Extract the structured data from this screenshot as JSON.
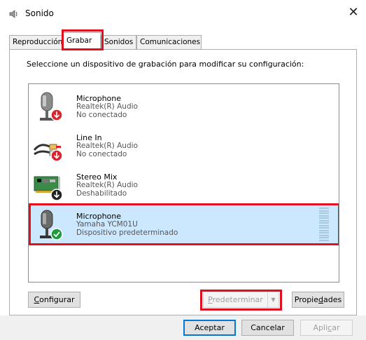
{
  "window": {
    "title": "Sonido",
    "icon": "speaker-icon",
    "close_glyph": "✕"
  },
  "tabs": [
    {
      "label": "Reproducción",
      "active": false
    },
    {
      "label": "Grabar",
      "active": true
    },
    {
      "label": "Sonidos",
      "active": false
    },
    {
      "label": "Comunicaciones",
      "active": false
    }
  ],
  "instruction": "Seleccione un dispositivo de grabación para modificar su configuración:",
  "devices": [
    {
      "name": "Microphone",
      "driver": "Realtek(R) Audio",
      "status": "No conectado",
      "icon": "microphone-icon",
      "badge": "disconnected-down-arrow",
      "selected": false
    },
    {
      "name": "Line In",
      "driver": "Realtek(R) Audio",
      "status": "No conectado",
      "icon": "line-in-cable-icon",
      "badge": "disconnected-down-arrow",
      "selected": false
    },
    {
      "name": "Stereo Mix",
      "driver": "Realtek(R) Audio",
      "status": "Deshabilitado",
      "icon": "sound-card-icon",
      "badge": "disabled-down-arrow",
      "selected": false
    },
    {
      "name": "Microphone",
      "driver": "Yamaha YCM01U",
      "status": "Dispositivo predeterminado",
      "icon": "microphone-icon",
      "badge": "default-check",
      "selected": true
    }
  ],
  "buttons": {
    "configure": {
      "pre": "",
      "ul": "C",
      "post": "onfigurar"
    },
    "set_default": {
      "pre": "",
      "ul": "P",
      "post": "redeterminar",
      "enabled": false
    },
    "properties": {
      "pre": "Propie",
      "ul": "d",
      "post": "ades"
    },
    "ok": "Aceptar",
    "cancel": "Cancelar",
    "apply": {
      "pre": "Apli",
      "ul": "c",
      "post": "ar",
      "enabled": false
    }
  },
  "colors": {
    "selection": "#cce8ff",
    "highlight_box": "#e0101e",
    "accent": "#0078d7",
    "check_green": "#1a9c3e",
    "badge_red": "#d9232d"
  }
}
